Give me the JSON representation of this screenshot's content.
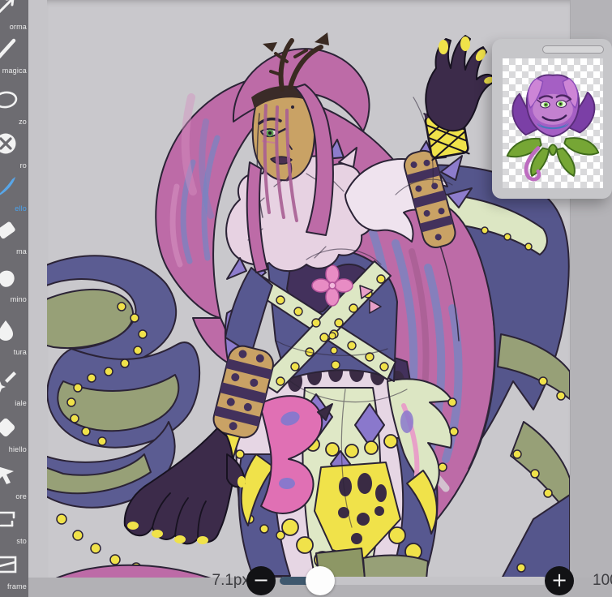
{
  "sidebar": {
    "selected_label_color": "#4aa2ee",
    "tools": [
      {
        "label": "orma",
        "icon": "transform-icon",
        "selected": false
      },
      {
        "label": "magica",
        "icon": "magic-wand-icon",
        "selected": false
      },
      {
        "label": "zo",
        "icon": "lasso-icon",
        "selected": false
      },
      {
        "label": "ro",
        "icon": "filter-icon",
        "selected": false
      },
      {
        "label": "ello",
        "icon": "brush-icon",
        "selected": true
      },
      {
        "label": "ma",
        "icon": "eraser-icon",
        "selected": false
      },
      {
        "label": "mino",
        "icon": "smudge-icon",
        "selected": false
      },
      {
        "label": "tura",
        "icon": "blur-icon",
        "selected": false
      },
      {
        "label": "iale",
        "icon": "special-pen-icon",
        "selected": false
      },
      {
        "label": "hiello",
        "icon": "bucket-icon",
        "selected": false
      },
      {
        "label": "ore",
        "icon": "cursor-icon",
        "selected": false
      },
      {
        "label": "sto",
        "icon": "text-icon",
        "selected": false
      },
      {
        "label": "frame",
        "icon": "frame-icon",
        "selected": false
      }
    ]
  },
  "reference_panel": {
    "image": "rose-plant-character"
  },
  "bottom_bar": {
    "brush_size_label": "7.1px",
    "decrease_label": "−",
    "increase_label": "+",
    "right_value": "100"
  },
  "colors": {
    "sidebar_bg": "#6d6c71",
    "canvas_bg": "#c9c8cc",
    "app_bg": "#b4b3b7",
    "accent_blue": "#4aa2ee",
    "slider_fill": "#3e586e",
    "hair_pink": "#bd6ba7",
    "outfit_navy": "#575890",
    "accent_yellow": "#f0e24a",
    "pale_green": "#dde7c4",
    "plum_dark": "#3c2b4a"
  }
}
